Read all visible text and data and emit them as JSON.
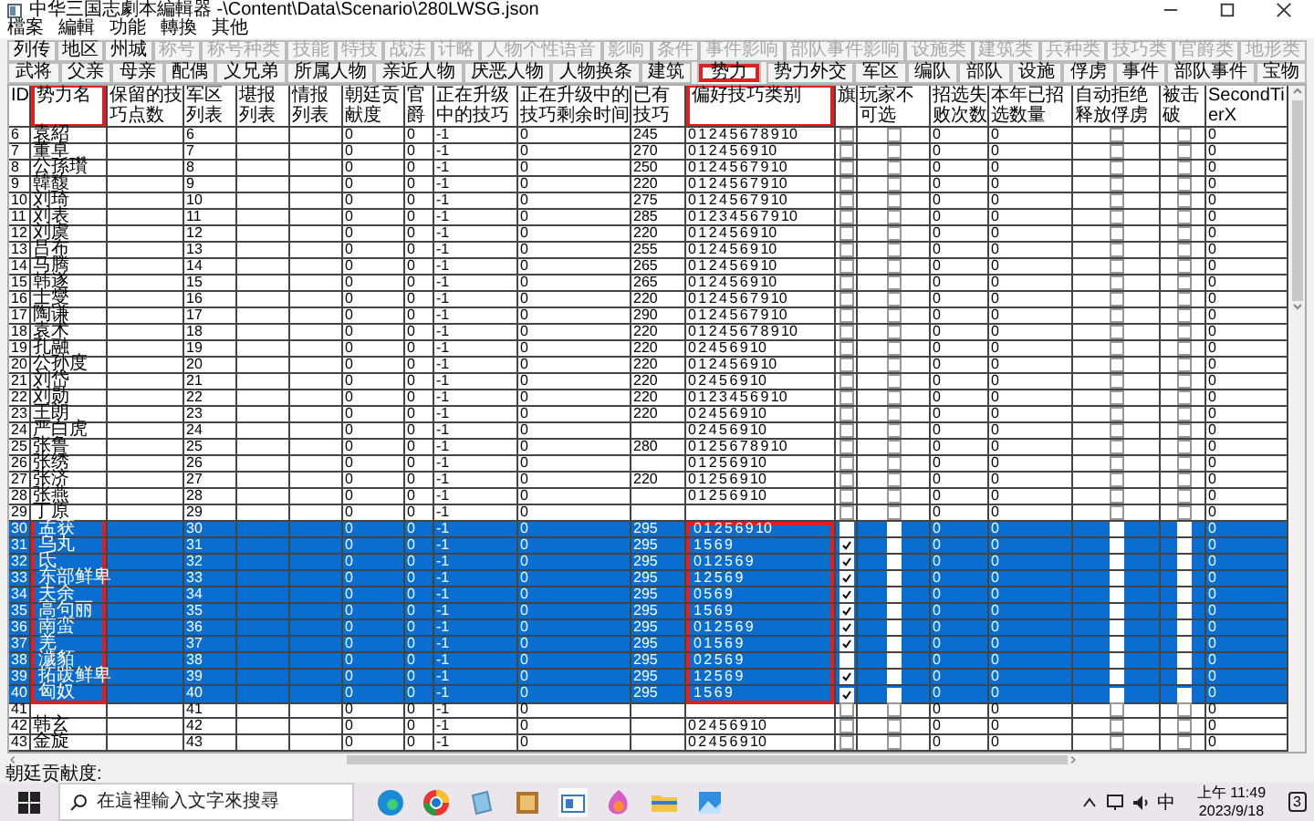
{
  "window": {
    "title": "中华三国志劇本編輯器 -\\Content\\Data\\Scenario\\280LWSG.json"
  },
  "menu": [
    "檔案",
    "編輯",
    "功能",
    "轉換",
    "其他"
  ],
  "tab_rows": [
    [
      {
        "label": "列传",
        "selected": false,
        "disabled": false
      },
      {
        "label": "地区",
        "selected": false,
        "disabled": false
      },
      {
        "label": "州城",
        "selected": false,
        "disabled": false
      },
      {
        "label": "称号",
        "selected": false,
        "disabled": true
      },
      {
        "label": "称号种类",
        "selected": false,
        "disabled": true
      },
      {
        "label": "技能",
        "selected": false,
        "disabled": true
      },
      {
        "label": "特技",
        "selected": false,
        "disabled": true
      },
      {
        "label": "战法",
        "selected": false,
        "disabled": true
      },
      {
        "label": "计略",
        "selected": false,
        "disabled": true
      },
      {
        "label": "人物个性语音",
        "selected": false,
        "disabled": true
      },
      {
        "label": "影响",
        "selected": false,
        "disabled": true
      },
      {
        "label": "条件",
        "selected": false,
        "disabled": true
      },
      {
        "label": "事件影响",
        "selected": false,
        "disabled": true
      },
      {
        "label": "部队事件影响",
        "selected": false,
        "disabled": true
      },
      {
        "label": "设施类",
        "selected": false,
        "disabled": true
      },
      {
        "label": "建筑类",
        "selected": false,
        "disabled": true
      },
      {
        "label": "兵种类",
        "selected": false,
        "disabled": true
      },
      {
        "label": "技巧类",
        "selected": false,
        "disabled": true
      },
      {
        "label": "官爵类",
        "selected": false,
        "disabled": true
      },
      {
        "label": "地形类",
        "selected": false,
        "disabled": true
      }
    ],
    [
      {
        "label": "武将",
        "selected": false,
        "disabled": false
      },
      {
        "label": "父亲",
        "selected": false,
        "disabled": false
      },
      {
        "label": "母亲",
        "selected": false,
        "disabled": false
      },
      {
        "label": "配偶",
        "selected": false,
        "disabled": false
      },
      {
        "label": "义兄弟",
        "selected": false,
        "disabled": false
      },
      {
        "label": "所属人物",
        "selected": false,
        "disabled": false
      },
      {
        "label": "亲近人物",
        "selected": false,
        "disabled": false
      },
      {
        "label": "厌恶人物",
        "selected": false,
        "disabled": false
      },
      {
        "label": "人物换条",
        "selected": false,
        "disabled": false
      },
      {
        "label": "建筑",
        "selected": false,
        "disabled": false
      },
      {
        "label": "势力",
        "selected": true,
        "disabled": false,
        "highlighted": true
      },
      {
        "label": "势力外交",
        "selected": false,
        "disabled": false
      },
      {
        "label": "军区",
        "selected": false,
        "disabled": false
      },
      {
        "label": "编队",
        "selected": false,
        "disabled": false
      },
      {
        "label": "部队",
        "selected": false,
        "disabled": false
      },
      {
        "label": "设施",
        "selected": false,
        "disabled": false
      },
      {
        "label": "俘虏",
        "selected": false,
        "disabled": false
      },
      {
        "label": "事件",
        "selected": false,
        "disabled": false
      },
      {
        "label": "部队事件",
        "selected": false,
        "disabled": false
      },
      {
        "label": "宝物",
        "selected": false,
        "disabled": false
      }
    ]
  ],
  "table": {
    "columns": [
      {
        "label": "ID",
        "kind": "text"
      },
      {
        "label": "势力名",
        "kind": "text",
        "highlighted": true
      },
      {
        "label": "保留的技巧点数",
        "kind": "text"
      },
      {
        "label": "军区列表",
        "kind": "text"
      },
      {
        "label": "堪报列表",
        "kind": "text"
      },
      {
        "label": "情报列表",
        "kind": "text"
      },
      {
        "label": "朝廷贡献度",
        "kind": "text"
      },
      {
        "label": "官爵",
        "kind": "text"
      },
      {
        "label": "正在升级中的技巧",
        "kind": "text"
      },
      {
        "label": "正在升级中的技巧剩余时间",
        "kind": "text"
      },
      {
        "label": "已有技巧",
        "kind": "text"
      },
      {
        "label": "偏好技巧类别",
        "kind": "text",
        "highlighted": true
      },
      {
        "label": "旗",
        "kind": "check"
      },
      {
        "label": "玩家不可选",
        "kind": "check"
      },
      {
        "label": "招选失败次数",
        "kind": "text"
      },
      {
        "label": "本年已招选数量",
        "kind": "text"
      },
      {
        "label": "自动拒绝释放俘虏",
        "kind": "check"
      },
      {
        "label": "被击破",
        "kind": "check"
      },
      {
        "label": "SecondTierX",
        "kind": "text"
      }
    ],
    "rows": [
      {
        "selected": false,
        "cells": [
          "6",
          "袁紹",
          null,
          "6",
          null,
          null,
          "0",
          "0",
          "-1",
          "0",
          "245",
          "0 1 2 4 5 6 7 8 9 10",
          false,
          false,
          "0",
          "0",
          false,
          false,
          "0"
        ]
      },
      {
        "selected": false,
        "cells": [
          "7",
          "董卓",
          null,
          "7",
          null,
          null,
          "0",
          "0",
          "-1",
          "0",
          "270",
          "0 1 2 4 5 6 9 10",
          false,
          false,
          "0",
          "0",
          false,
          false,
          "0"
        ]
      },
      {
        "selected": false,
        "cells": [
          "8",
          "公孫瓚",
          null,
          "8",
          null,
          null,
          "0",
          "0",
          "-1",
          "0",
          "250",
          "0 1 2 4 5 6 7 9 10",
          false,
          false,
          "0",
          "0",
          false,
          false,
          "0"
        ]
      },
      {
        "selected": false,
        "cells": [
          "9",
          "韓馥",
          null,
          "9",
          null,
          null,
          "0",
          "0",
          "-1",
          "0",
          "220",
          "0 1 2 4 5 6 7 9 10",
          false,
          false,
          "0",
          "0",
          false,
          false,
          "0"
        ]
      },
      {
        "selected": false,
        "cells": [
          "10",
          "刘琦",
          null,
          "10",
          null,
          null,
          "0",
          "0",
          "-1",
          "0",
          "275",
          "0 1 2 4 5 6 7 9 10",
          false,
          false,
          "0",
          "0",
          false,
          false,
          "0"
        ]
      },
      {
        "selected": false,
        "cells": [
          "11",
          "刘表",
          null,
          "11",
          null,
          null,
          "0",
          "0",
          "-1",
          "0",
          "285",
          "0 1 2 3 4 5 6 7 9 10",
          false,
          false,
          "0",
          "0",
          false,
          false,
          "0"
        ]
      },
      {
        "selected": false,
        "cells": [
          "12",
          "刘虞",
          null,
          "12",
          null,
          null,
          "0",
          "0",
          "-1",
          "0",
          "220",
          "0 1 2 4 5 6 9 10",
          false,
          false,
          "0",
          "0",
          false,
          false,
          "0"
        ]
      },
      {
        "selected": false,
        "cells": [
          "13",
          "吕布",
          null,
          "13",
          null,
          null,
          "0",
          "0",
          "-1",
          "0",
          "255",
          "0 1 2 4 5 6 9 10",
          false,
          false,
          "0",
          "0",
          false,
          false,
          "0"
        ]
      },
      {
        "selected": false,
        "cells": [
          "14",
          "马腾",
          null,
          "14",
          null,
          null,
          "0",
          "0",
          "-1",
          "0",
          "265",
          "0 1 2 4 5 6 9 10",
          false,
          false,
          "0",
          "0",
          false,
          false,
          "0"
        ]
      },
      {
        "selected": false,
        "cells": [
          "15",
          "韩遂",
          null,
          "15",
          null,
          null,
          "0",
          "0",
          "-1",
          "0",
          "265",
          "0 1 2 4 5 6 9 10",
          false,
          false,
          "0",
          "0",
          false,
          false,
          "0"
        ]
      },
      {
        "selected": false,
        "cells": [
          "16",
          "士燮",
          null,
          "16",
          null,
          null,
          "0",
          "0",
          "-1",
          "0",
          "220",
          "0 1 2 4 5 6 7 9 10",
          false,
          false,
          "0",
          "0",
          false,
          false,
          "0"
        ]
      },
      {
        "selected": false,
        "cells": [
          "17",
          "陶谦",
          null,
          "17",
          null,
          null,
          "0",
          "0",
          "-1",
          "0",
          "290",
          "0 1 2 4 5 6 7 9 10",
          false,
          false,
          "0",
          "0",
          false,
          false,
          "0"
        ]
      },
      {
        "selected": false,
        "cells": [
          "18",
          "袁术",
          null,
          "18",
          null,
          null,
          "0",
          "0",
          "-1",
          "0",
          "220",
          "0 1 2 4 5 6 7 8 9 10",
          false,
          false,
          "0",
          "0",
          false,
          false,
          "0"
        ]
      },
      {
        "selected": false,
        "cells": [
          "19",
          "孔融",
          null,
          "19",
          null,
          null,
          "0",
          "0",
          "-1",
          "0",
          "220",
          "0 2 4 5 6 9 10",
          false,
          false,
          "0",
          "0",
          false,
          false,
          "0"
        ]
      },
      {
        "selected": false,
        "cells": [
          "20",
          "公孙度",
          null,
          "20",
          null,
          null,
          "0",
          "0",
          "-1",
          "0",
          "220",
          "0 1 2 4 5 6 9 10",
          false,
          false,
          "0",
          "0",
          false,
          false,
          "0"
        ]
      },
      {
        "selected": false,
        "cells": [
          "21",
          "刘岱",
          null,
          "21",
          null,
          null,
          "0",
          "0",
          "-1",
          "0",
          "220",
          "0 2 4 5 6 9 10",
          false,
          false,
          "0",
          "0",
          false,
          false,
          "0"
        ]
      },
      {
        "selected": false,
        "cells": [
          "22",
          "刘勋",
          null,
          "22",
          null,
          null,
          "0",
          "0",
          "-1",
          "0",
          "220",
          "0 1 2 3 4 5 6 9 10",
          false,
          false,
          "0",
          "0",
          false,
          false,
          "0"
        ]
      },
      {
        "selected": false,
        "cells": [
          "23",
          "王朗",
          null,
          "23",
          null,
          null,
          "0",
          "0",
          "-1",
          "0",
          "220",
          "0 2 4 5 6 9 10",
          false,
          false,
          "0",
          "0",
          false,
          false,
          "0"
        ]
      },
      {
        "selected": false,
        "cells": [
          "24",
          "严白虎",
          null,
          "24",
          null,
          null,
          "0",
          "0",
          "-1",
          "0",
          null,
          "0 2 4 5 6 9 10",
          false,
          false,
          "0",
          "0",
          false,
          false,
          "0"
        ]
      },
      {
        "selected": false,
        "cells": [
          "25",
          "张鲁",
          null,
          "25",
          null,
          null,
          "0",
          "0",
          "-1",
          "0",
          "280",
          "0 1 2 5 6 7 8 9 10",
          false,
          false,
          "0",
          "0",
          false,
          false,
          "0"
        ]
      },
      {
        "selected": false,
        "cells": [
          "26",
          "张绣",
          null,
          "26",
          null,
          null,
          "0",
          "0",
          "-1",
          "0",
          null,
          "0 1 2 5 6 9 10",
          false,
          false,
          "0",
          "0",
          false,
          false,
          "0"
        ]
      },
      {
        "selected": false,
        "cells": [
          "27",
          "张济",
          null,
          "27",
          null,
          null,
          "0",
          "0",
          "-1",
          "0",
          "220",
          "0 1 2 5 6 9 10",
          false,
          false,
          "0",
          "0",
          false,
          false,
          "0"
        ]
      },
      {
        "selected": false,
        "cells": [
          "28",
          "张燕",
          null,
          "28",
          null,
          null,
          "0",
          "0",
          "-1",
          "0",
          null,
          "0 1 2 5 6 9 10",
          false,
          false,
          "0",
          "0",
          false,
          false,
          "0"
        ]
      },
      {
        "selected": false,
        "cells": [
          "29",
          "丁原",
          null,
          "29",
          null,
          null,
          "0",
          "0",
          "-1",
          "0",
          null,
          null,
          false,
          false,
          "0",
          "0",
          false,
          false,
          "0"
        ]
      },
      {
        "selected": true,
        "cells": [
          "30",
          "孟获",
          null,
          "30",
          null,
          null,
          "0",
          "0",
          "-1",
          "0",
          "295",
          "0 1 2 5 6 9 10",
          false,
          false,
          "0",
          "0",
          false,
          false,
          "0"
        ]
      },
      {
        "selected": true,
        "cells": [
          "31",
          "乌丸",
          null,
          "31",
          null,
          null,
          "0",
          "0",
          "-1",
          "0",
          "295",
          "1 5 6 9",
          true,
          false,
          "0",
          "0",
          false,
          false,
          "0"
        ]
      },
      {
        "selected": true,
        "cells": [
          "32",
          "氐",
          null,
          "32",
          null,
          null,
          "0",
          "0",
          "-1",
          "0",
          "295",
          "0 1 2 5 6 9",
          true,
          false,
          "0",
          "0",
          false,
          false,
          "0"
        ]
      },
      {
        "selected": true,
        "cells": [
          "33",
          "东部鲜卑",
          null,
          "33",
          null,
          null,
          "0",
          "0",
          "-1",
          "0",
          "295",
          "1 2 5 6 9",
          true,
          false,
          "0",
          "0",
          false,
          false,
          "0"
        ]
      },
      {
        "selected": true,
        "cells": [
          "34",
          "夫余",
          null,
          "34",
          null,
          null,
          "0",
          "0",
          "-1",
          "0",
          "295",
          "0 5 6 9",
          true,
          false,
          "0",
          "0",
          false,
          false,
          "0"
        ]
      },
      {
        "selected": true,
        "cells": [
          "35",
          "高句丽",
          null,
          "35",
          null,
          null,
          "0",
          "0",
          "-1",
          "0",
          "295",
          "1 5 6 9",
          true,
          false,
          "0",
          "0",
          false,
          false,
          "0"
        ]
      },
      {
        "selected": true,
        "cells": [
          "36",
          "南蛮",
          null,
          "36",
          null,
          null,
          "0",
          "0",
          "-1",
          "0",
          "295",
          "0 1 2 5 6 9",
          true,
          false,
          "0",
          "0",
          false,
          false,
          "0"
        ]
      },
      {
        "selected": true,
        "cells": [
          "37",
          "羌",
          null,
          "37",
          null,
          null,
          "0",
          "0",
          "-1",
          "0",
          "295",
          "0 1 5 6 9",
          true,
          false,
          "0",
          "0",
          false,
          false,
          "0"
        ]
      },
      {
        "selected": true,
        "cells": [
          "38",
          "濊貊",
          null,
          "38",
          null,
          null,
          "0",
          "0",
          "-1",
          "0",
          "295",
          "0 2 5 6 9",
          false,
          false,
          "0",
          "0",
          false,
          false,
          "0"
        ]
      },
      {
        "selected": true,
        "cells": [
          "39",
          "拓跋鲜卑",
          null,
          "39",
          null,
          null,
          "0",
          "0",
          "-1",
          "0",
          "295",
          "1 2 5 6 9",
          true,
          false,
          "0",
          "0",
          false,
          false,
          "0"
        ]
      },
      {
        "selected": true,
        "cells": [
          "40",
          "匈奴",
          null,
          "40",
          null,
          null,
          "0",
          "0",
          "-1",
          "0",
          "295",
          "1 5 6 9",
          true,
          false,
          "0",
          "0",
          false,
          false,
          "0"
        ]
      },
      {
        "selected": false,
        "cells": [
          "41",
          null,
          null,
          "41",
          null,
          null,
          "0",
          "0",
          "-1",
          "0",
          null,
          null,
          false,
          false,
          "0",
          "0",
          false,
          false,
          "0"
        ]
      },
      {
        "selected": false,
        "cells": [
          "42",
          "韩玄",
          null,
          "42",
          null,
          null,
          "0",
          "0",
          "-1",
          "0",
          null,
          "0 2 4 5 6 9 10",
          false,
          false,
          "0",
          "0",
          false,
          false,
          "0"
        ]
      },
      {
        "selected": false,
        "cells": [
          "43",
          "金旋",
          null,
          "43",
          null,
          null,
          "0",
          "0",
          "-1",
          "0",
          null,
          "0 2 4 5 6 9 10",
          false,
          false,
          "0",
          "0",
          false,
          false,
          "0"
        ]
      }
    ]
  },
  "status_bar": "朝廷贡献度:",
  "taskbar": {
    "search": {
      "placeholder": "在這裡輸入文字來搜尋"
    },
    "ime": "中",
    "time": "上午 11:49",
    "date": "2023/9/18",
    "notifications": "3"
  }
}
